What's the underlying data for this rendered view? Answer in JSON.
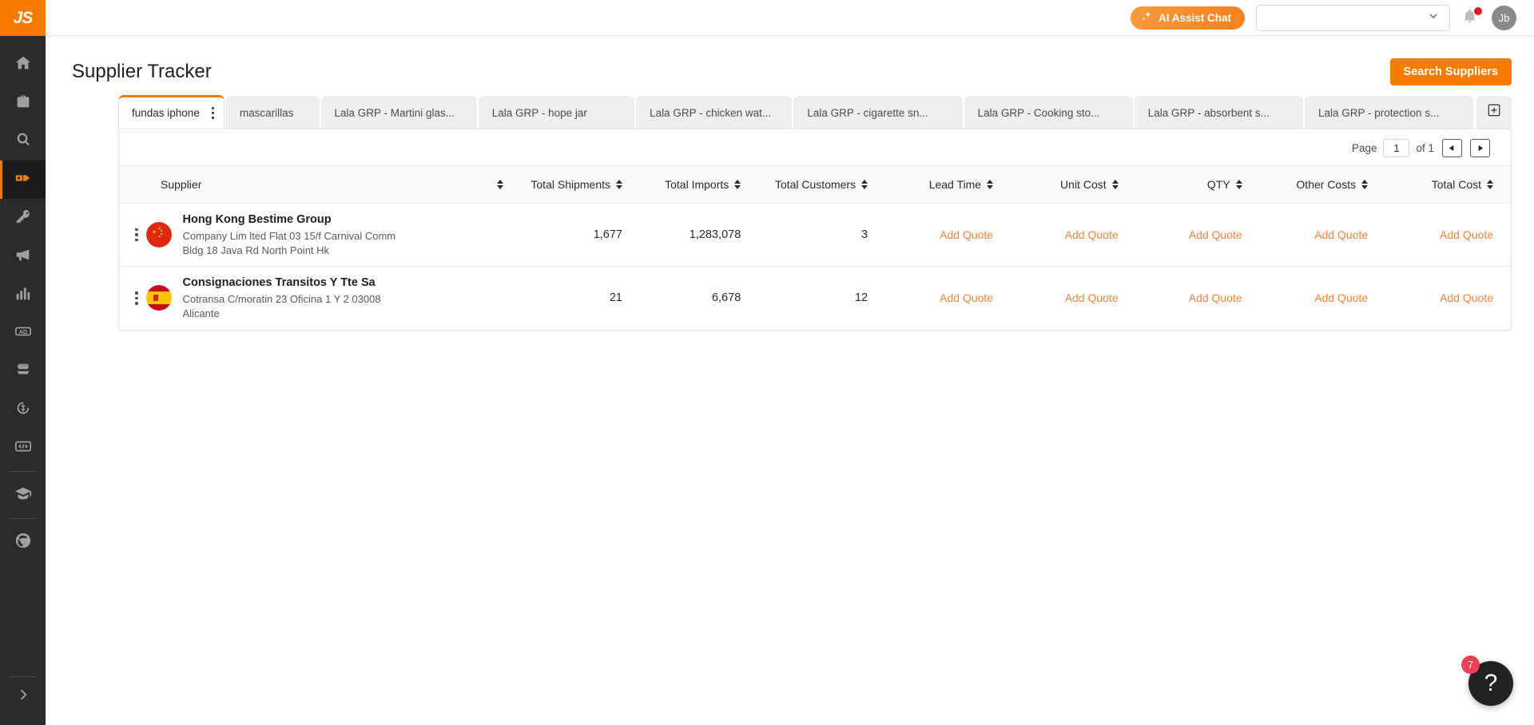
{
  "brand": {
    "logo_text": "JS",
    "accent": "#f57c00",
    "link_color": "#f0843c"
  },
  "sidebar": {
    "items": [
      {
        "icon": "home-icon",
        "name": "home",
        "active": false
      },
      {
        "icon": "toolbox-icon",
        "name": "toolbox",
        "active": false
      },
      {
        "icon": "keyword-search-icon",
        "name": "keyword-search",
        "active": false
      },
      {
        "icon": "supplier-tracker-icon",
        "name": "supplier-tracker",
        "active": true
      },
      {
        "icon": "key-icon",
        "name": "keywords",
        "active": false
      },
      {
        "icon": "megaphone-icon",
        "name": "promotions",
        "active": false
      },
      {
        "icon": "bar-chart-icon",
        "name": "analytics",
        "active": false
      },
      {
        "icon": "ad-icon",
        "name": "advertising",
        "active": false
      },
      {
        "icon": "inventory-icon",
        "name": "inventory",
        "active": false
      },
      {
        "icon": "refund-icon",
        "name": "refunds",
        "active": false
      },
      {
        "icon": "code-icon",
        "name": "developer",
        "active": false
      },
      {
        "icon": "academy-icon",
        "name": "academy",
        "active": false
      },
      {
        "icon": "extension-icon",
        "name": "extension",
        "active": false
      }
    ],
    "expand_icon": "chevron-right-icon"
  },
  "topbar": {
    "ai_chat_label": "AI Assist Chat",
    "ai_chat_icon": "sparkle-icon",
    "select_value": "",
    "select_icon": "chevron-down-icon",
    "bell_icon": "bell-icon",
    "has_notification": true,
    "avatar_initials": "Jb"
  },
  "page": {
    "title": "Supplier Tracker",
    "search_suppliers_label": "Search Suppliers"
  },
  "tabs": {
    "items": [
      {
        "label": "fundas iphone",
        "active": true
      },
      {
        "label": "mascarillas",
        "active": false
      },
      {
        "label": "Lala GRP - Martini glas...",
        "active": false
      },
      {
        "label": "Lala GRP - hope jar",
        "active": false
      },
      {
        "label": "Lala GRP - chicken wat...",
        "active": false
      },
      {
        "label": "Lala GRP - cigarette sn...",
        "active": false
      },
      {
        "label": "Lala GRP - Cooking sto...",
        "active": false
      },
      {
        "label": "Lala GRP - absorbent s...",
        "active": false
      },
      {
        "label": "Lala GRP - protection s...",
        "active": false
      }
    ],
    "add_tab_icon": "plus-box-icon"
  },
  "pager": {
    "page_label": "Page",
    "page_value": "1",
    "of_label": "of 1",
    "prev_icon": "triangle-left-icon",
    "next_icon": "triangle-right-icon"
  },
  "table": {
    "columns": [
      {
        "label": "Supplier",
        "align": "left"
      },
      {
        "label": "Total Shipments",
        "align": "right"
      },
      {
        "label": "Total Imports",
        "align": "right"
      },
      {
        "label": "Total Customers",
        "align": "right"
      },
      {
        "label": "Lead Time",
        "align": "right"
      },
      {
        "label": "Unit Cost",
        "align": "right"
      },
      {
        "label": "QTY",
        "align": "right"
      },
      {
        "label": "Other Costs",
        "align": "right"
      },
      {
        "label": "Total Cost",
        "align": "right"
      }
    ],
    "rows": [
      {
        "flag": "cn-flag",
        "name": "Hong Kong Bestime Group",
        "address_line1": "Company Lim lted Flat 03 15/f Carnival Comm",
        "address_line2": "Bldg 18 Java Rd North Point Hk",
        "total_shipments": "1,677",
        "total_imports": "1,283,078",
        "total_customers": "3",
        "lead_time": "Add Quote",
        "unit_cost": "Add Quote",
        "qty": "Add Quote",
        "other_costs": "Add Quote",
        "total_cost": "Add Quote"
      },
      {
        "flag": "es-flag",
        "name": "Consignaciones Transitos Y Tte Sa",
        "address_line1": "Cotransa C/moratin 23 Oficina 1 Y 2 03008",
        "address_line2": "Alicante",
        "total_shipments": "21",
        "total_imports": "6,678",
        "total_customers": "12",
        "lead_time": "Add Quote",
        "unit_cost": "Add Quote",
        "qty": "Add Quote",
        "other_costs": "Add Quote",
        "total_cost": "Add Quote"
      }
    ]
  },
  "help_widget": {
    "icon": "question-mark-icon",
    "badge": "7"
  }
}
